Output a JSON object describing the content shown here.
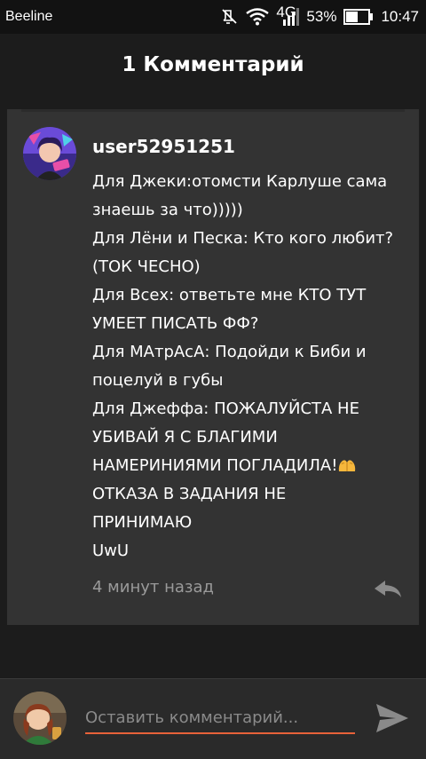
{
  "status_bar": {
    "carrier": "Beeline",
    "network": "4G",
    "battery": "53%",
    "time": "10:47",
    "icons": [
      "mute-icon",
      "wifi-icon",
      "signal-icon",
      "battery-icon"
    ]
  },
  "header": {
    "title": "1 Комментарий"
  },
  "comment": {
    "username": "user52951251",
    "lines": [
      "Для Джеки:отомсти Карлуше сама",
      "знаешь за что)))))",
      "Для Лёни и Песка: Кто кого любит?",
      "(ТОК ЧЕСНО)",
      "Для Всех: ответьте мне КТО ТУТ",
      "УМЕЕТ ПИСАТЬ ФФ?",
      "Для МАтрАсА: Подойди к Биби и",
      "поцелуй в губы",
      "Для Джеффа: ПОЖАЛУЙСТА НЕ",
      "УБИВАЙ Я С БЛАГИМИ",
      "НАМЕРИНИЯМИ ПОГЛАДИЛА!",
      "ОТКАЗА В ЗАДАНИЯ НЕ",
      "ПРИНИМАЮ",
      "UwU"
    ],
    "emoji": "pleading-hands-icon",
    "timestamp": "4 минут назад",
    "reply_icon": "reply-icon"
  },
  "input": {
    "placeholder": "Оставить комментарий...",
    "value": "",
    "send_icon": "send-icon"
  },
  "colors": {
    "background": "#1c1c1c",
    "card": "#333333",
    "accent": "#e8623a",
    "muted": "#9a9a9a"
  }
}
